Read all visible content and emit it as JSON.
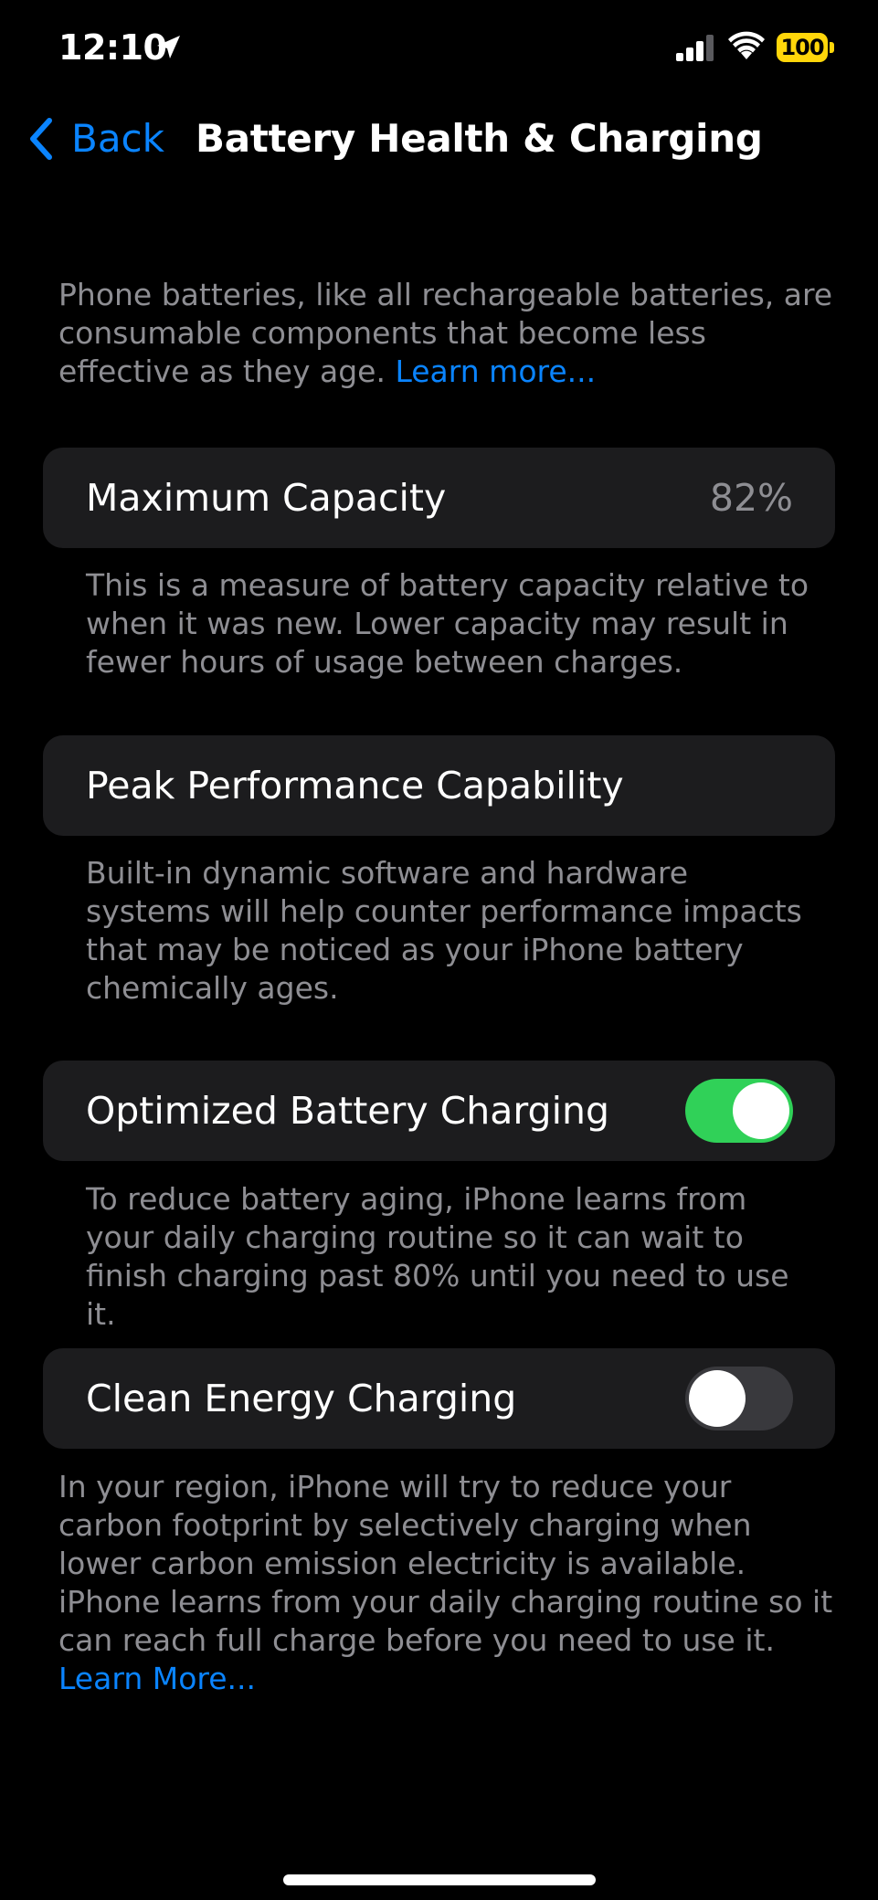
{
  "status_bar": {
    "time": "12:10",
    "battery_level": "100",
    "location_icon": "location-arrow",
    "signal_icon": "cellular-signal",
    "wifi_icon": "wifi"
  },
  "nav": {
    "back_label": "Back",
    "title": "Battery Health & Charging"
  },
  "intro": {
    "text": "Phone batteries, like all rechargeable batteries, are consumable components that become less effective as they age. ",
    "link": "Learn more..."
  },
  "maximum_capacity": {
    "label": "Maximum Capacity",
    "value": "82%",
    "footer": "This is a measure of battery capacity relative to when it was new. Lower capacity may result in fewer hours of usage between charges."
  },
  "peak_performance": {
    "label": "Peak Performance Capability",
    "footer": "Built-in dynamic software and hardware systems will help counter performance impacts that may be noticed as your iPhone battery chemically ages."
  },
  "optimized_charging": {
    "label": "Optimized Battery Charging",
    "enabled": true,
    "footer": "To reduce battery aging, iPhone learns from your daily charging routine so it can wait to finish charging past 80% until you need to use it."
  },
  "clean_energy": {
    "label": "Clean Energy Charging",
    "enabled": false,
    "footer": "In your region, iPhone will try to reduce your carbon footprint by selectively charging when lower carbon emission electricity is available. iPhone learns from your daily charging routine so it can reach full charge before you need to use it. ",
    "link": "Learn More..."
  },
  "colors": {
    "background": "#000000",
    "cell": "#1c1c1e",
    "accent": "#0a84ff",
    "secondary_text": "#8e8e93",
    "toggle_on": "#30d158",
    "toggle_off": "#39393d",
    "battery": "#ffd60a"
  }
}
